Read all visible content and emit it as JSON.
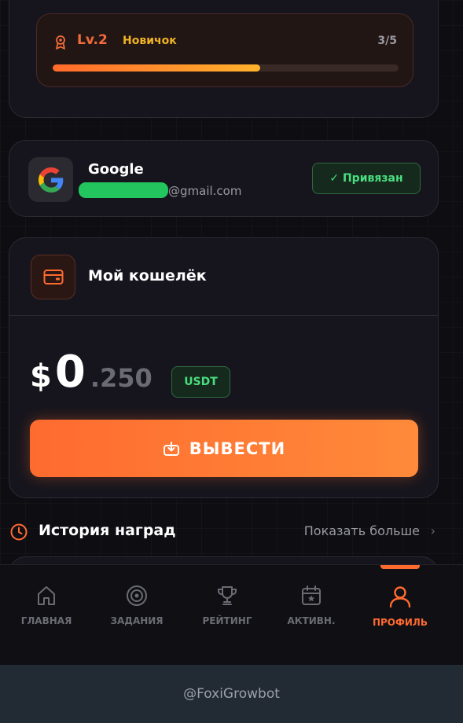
{
  "level": {
    "label": "Lv.2",
    "rank": "Новичок",
    "progress_text": "3/5",
    "progress_fraction": 0.6
  },
  "google": {
    "title": "Google",
    "email": "@gmail.com",
    "status": "✓ Привязан"
  },
  "wallet": {
    "title": "Мой кошелёк",
    "currency_symbol": "$",
    "balance_integer": "0",
    "balance_decimal": ".250",
    "currency_badge": "USDT",
    "withdraw_label": "ВЫВЕСТИ"
  },
  "history": {
    "title": "История наград",
    "more_label": "Показать больше",
    "chevron": "›"
  },
  "nav": {
    "items": [
      {
        "label": "ГЛАВНАЯ",
        "icon": "home-icon"
      },
      {
        "label": "ЗАДАНИЯ",
        "icon": "target-icon"
      },
      {
        "label": "РЕЙТИНГ",
        "icon": "trophy-icon"
      },
      {
        "label": "АКТИВН.",
        "icon": "calendar-icon"
      },
      {
        "label": "ПРОФИЛЬ",
        "icon": "user-icon"
      }
    ],
    "active_index": 4
  },
  "footer": {
    "bot_name": "@FoxiGrowbot"
  },
  "colors": {
    "accent": "#ff6b2f",
    "success": "#4ade80",
    "level_rank": "#f0b324"
  }
}
